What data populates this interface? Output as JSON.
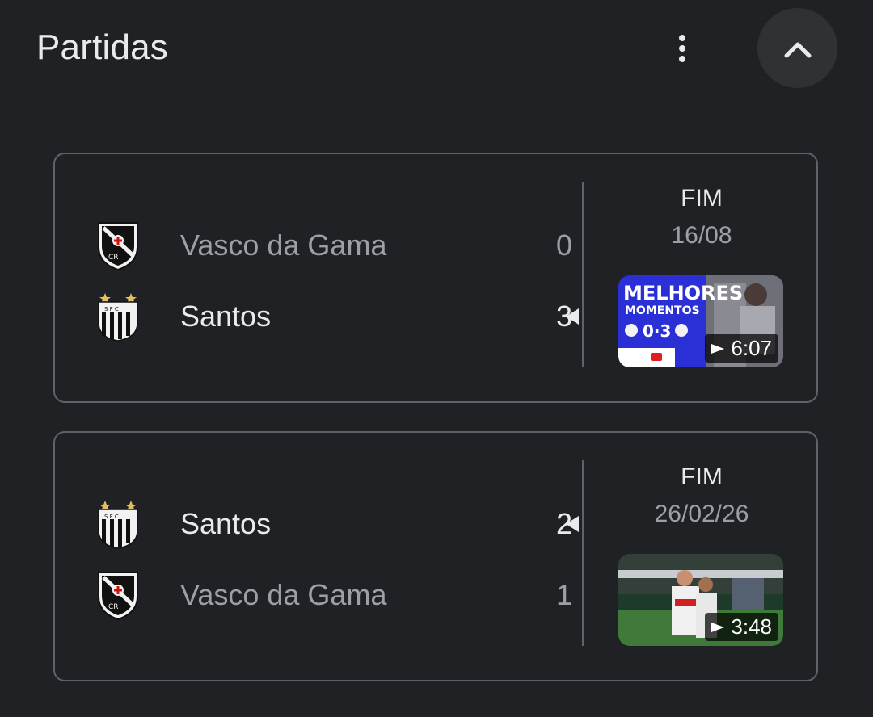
{
  "header": {
    "title": "Partidas",
    "more_icon": "more-vert-icon",
    "collapse_icon": "chevron-up-icon"
  },
  "matches": [
    {
      "teams": [
        {
          "name": "Vasco da Gama",
          "score": "0",
          "logo": "vasco-crest-icon",
          "winner": false
        },
        {
          "name": "Santos",
          "score": "3",
          "logo": "santos-crest-icon",
          "winner": true
        }
      ],
      "status": "FIM",
      "date": "16/08",
      "video": {
        "duration": "6:07",
        "thumb_text_1": "MELHORES",
        "thumb_text_2": "MOMENTOS",
        "thumb_score": "0·3"
      }
    },
    {
      "teams": [
        {
          "name": "Santos",
          "score": "2",
          "logo": "santos-crest-icon",
          "winner": true
        },
        {
          "name": "Vasco da Gama",
          "score": "1",
          "logo": "vasco-crest-icon",
          "winner": false
        }
      ],
      "status": "FIM",
      "date": "26/02/26",
      "video": {
        "duration": "3:48"
      }
    }
  ],
  "colors": {
    "background": "#202124",
    "card_border": "#5f6368",
    "text_primary": "#e8eaed",
    "text_secondary": "#9aa0a6",
    "thumb_blue": "#2a2fd6"
  }
}
